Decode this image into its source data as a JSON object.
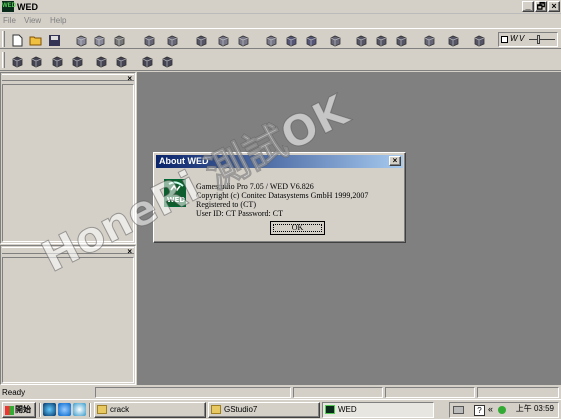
{
  "window": {
    "title": "WED",
    "icon_text": "WED"
  },
  "window_controls": {
    "minimize": "_",
    "maximize": "🗗",
    "close": "×"
  },
  "menu": [
    "File",
    "View",
    "Help"
  ],
  "toolbar_icons_row1": [
    "new-file-icon",
    "open-folder-icon",
    "save-icon",
    "copy-icon",
    "paste-icon",
    "undo-icon",
    "build-icon",
    "run-icon",
    "move-icon",
    "cube-icon",
    "cube-add-icon",
    "light-icon",
    "path-icon",
    "entity-icon",
    "wall-icon",
    "shield-icon",
    "shield-add-icon",
    "shield-remove-icon",
    "link-icon",
    "map-icon",
    "grid-icon"
  ],
  "toolbar_icons_row2": [
    "camera-icon",
    "eye-icon",
    "eye-left-icon",
    "eye-right-icon",
    "film-icon",
    "film-play-icon",
    "script-icon",
    "script-run-icon"
  ],
  "panes": [
    {
      "close": "×"
    },
    {
      "close": "×"
    }
  ],
  "dialog": {
    "title": "About WED",
    "close": "×",
    "lines": [
      "Gamestudio Pro 7.05 / WED V6.826",
      "Copyright (c) Conitec Datasystems GmbH 1999,2007",
      "Registered to (CT)",
      "User ID: CT Password: CT"
    ],
    "ok_label": "OK"
  },
  "status": {
    "text": "Ready"
  },
  "taskbar": {
    "start_label": "開始",
    "tasks": [
      {
        "label": "crack",
        "icon": "folder-icon"
      },
      {
        "label": "GStudio7",
        "icon": "folder-icon"
      },
      {
        "label": "WED",
        "icon": "wed-icon"
      }
    ],
    "clock": "上午 03:59",
    "tray_chevron": "«"
  },
  "watermark": "HoneRi 測試OK",
  "colors": {
    "workspace": "#808080",
    "dialog_title_start": "#0a246a",
    "dialog_title_end": "#a6caf0",
    "logo_green": "#0f5c2c"
  }
}
